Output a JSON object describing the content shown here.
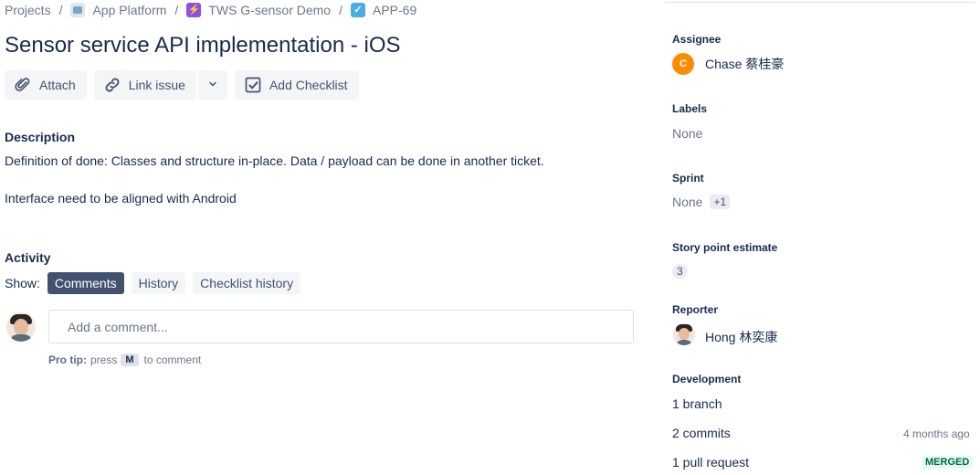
{
  "breadcrumb": {
    "projects": "Projects",
    "platform": "App Platform",
    "epic": "TWS G-sensor Demo",
    "issue_key": "APP-69",
    "separator": "/"
  },
  "issue": {
    "title": "Sensor service API implementation - iOS"
  },
  "toolbar": {
    "attach": "Attach",
    "link_issue": "Link issue",
    "add_checklist": "Add Checklist"
  },
  "description": {
    "heading": "Description",
    "line1": "Definition of done: Classes and structure in-place. Data / payload can be done in another ticket.",
    "line2": "Interface need to be aligned with Android"
  },
  "activity": {
    "heading": "Activity",
    "show_label": "Show:",
    "tabs": [
      "Comments",
      "History",
      "Checklist history"
    ],
    "active_tab": "Comments",
    "comment_placeholder": "Add a comment...",
    "protip_label": "Pro tip:",
    "protip_press": "press",
    "protip_key": "M",
    "protip_suffix": "to comment"
  },
  "sidebar": {
    "assignee_label": "Assignee",
    "assignee_initial": "C",
    "assignee_name": "Chase 蔡桂豪",
    "labels_label": "Labels",
    "labels_value": "None",
    "sprint_label": "Sprint",
    "sprint_value": "None",
    "sprint_extra": "+1",
    "story_label": "Story point estimate",
    "story_value": "3",
    "reporter_label": "Reporter",
    "reporter_name": "Hong 林奕康",
    "development_label": "Development",
    "branch": "1 branch",
    "commits": "2 commits",
    "commits_time": "4 months ago",
    "pull_request": "1 pull request",
    "pr_status": "MERGED"
  },
  "colors": {
    "primary_text": "#172b4d",
    "muted_text": "#6b778c",
    "active_tab_bg": "#42526e",
    "assignee_avatar": "#ff8b00",
    "merged_text": "#006644",
    "merged_bg": "#e3fcef"
  }
}
